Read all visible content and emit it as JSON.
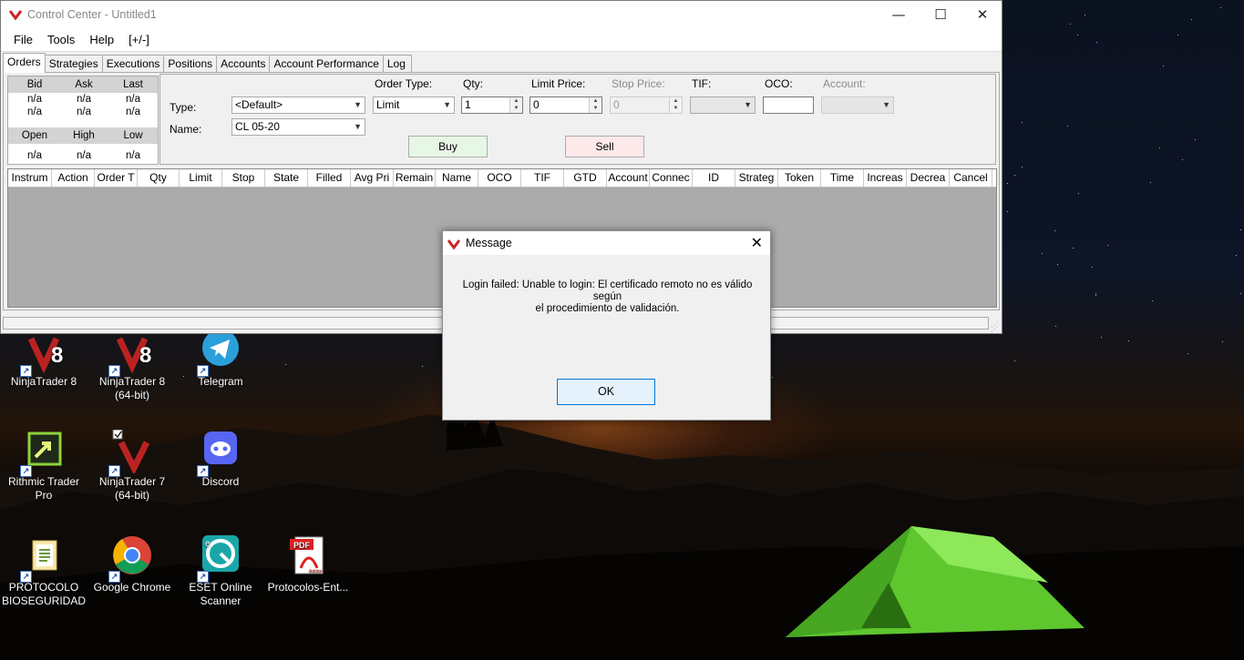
{
  "window": {
    "title": "Control Center - Untitled1",
    "controls": {
      "minimize": "—",
      "maximize": "☐",
      "close": "✕"
    }
  },
  "menu": [
    "File",
    "Tools",
    "Help",
    "[+/-]"
  ],
  "tabs": [
    "Orders",
    "Strategies",
    "Executions",
    "Positions",
    "Accounts",
    "Account Performance",
    "Log"
  ],
  "active_tab": "Orders",
  "quote": {
    "row1_headers": [
      "Bid",
      "Ask",
      "Last"
    ],
    "row1_values_a": [
      "n/a",
      "n/a",
      "n/a"
    ],
    "row1_values_b": [
      "n/a",
      "n/a",
      "n/a"
    ],
    "row2_headers": [
      "Open",
      "High",
      "Low"
    ],
    "row2_values": [
      "n/a",
      "n/a",
      "n/a"
    ]
  },
  "order_entry": {
    "type_label": "Type:",
    "type_value": "<Default>",
    "name_label": "Name:",
    "name_value": "CL 05-20",
    "order_type_label": "Order Type:",
    "order_type_value": "Limit",
    "qty_label": "Qty:",
    "qty_value": "1",
    "limit_price_label": "Limit Price:",
    "limit_price_value": "0",
    "stop_price_label": "Stop Price:",
    "stop_price_value": "0",
    "tif_label": "TIF:",
    "tif_value": "",
    "oco_label": "OCO:",
    "oco_value": "",
    "account_label": "Account:",
    "account_value": "",
    "buy_label": "Buy",
    "sell_label": "Sell"
  },
  "grid_columns": [
    "Instrum",
    "Action",
    "Order T",
    "Qty",
    "Limit",
    "Stop",
    "State",
    "Filled",
    "Avg Pri",
    "Remain",
    "Name",
    "OCO",
    "TIF",
    "GTD",
    "Account",
    "Connec",
    "ID",
    "Strateg",
    "Token",
    "Time",
    "Increas",
    "Decrea",
    "Cancel"
  ],
  "dialog": {
    "title": "Message",
    "close": "✕",
    "message_line1": "Login failed: Unable to login: El certificado remoto no es válido según",
    "message_line2": "el procedimiento de validación.",
    "ok_label": "OK"
  },
  "desktop_icons": [
    {
      "icon": "ninjatrader-8-icon",
      "label1": "NinjaTrader 8",
      "label2": ""
    },
    {
      "icon": "ninjatrader-8-64-icon",
      "label1": "NinjaTrader 8",
      "label2": "(64-bit)"
    },
    {
      "icon": "telegram-icon",
      "label1": "Telegram",
      "label2": ""
    },
    {
      "icon": "rithmic-icon",
      "label1": "Rithmic Trader",
      "label2": "Pro"
    },
    {
      "icon": "ninjatrader-7-icon",
      "label1": "NinjaTrader 7",
      "label2": "(64-bit)"
    },
    {
      "icon": "discord-icon",
      "label1": "Discord",
      "label2": ""
    },
    {
      "icon": "folder-icon",
      "label1": "PROTOCOLO",
      "label2": "BIOSEGURIDAD"
    },
    {
      "icon": "chrome-icon",
      "label1": "Google Chrome",
      "label2": ""
    },
    {
      "icon": "eset-icon",
      "label1": "ESET Online",
      "label2": "Scanner"
    },
    {
      "icon": "pdf-icon",
      "label1": "Protocolos-Ent...",
      "label2": ""
    }
  ],
  "pdf_badge": "PDF",
  "pdf_brand": "Adobe",
  "colors": {
    "buy_button": "#e6f7e6",
    "sell_button": "#fde8ea",
    "accent": "#0078d7",
    "tent": "#6fd23a"
  }
}
